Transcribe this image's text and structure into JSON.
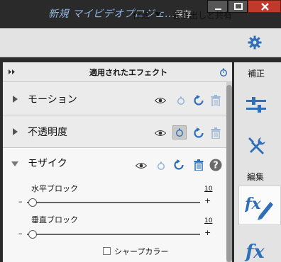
{
  "titlebar": {
    "title": "新規 マイビデオプロジェ...",
    "save": "保存"
  },
  "menubar": {
    "create": "作成",
    "share": "書き出しと共有"
  },
  "panel": {
    "title": "適用されたエフェクト"
  },
  "rightbar": {
    "adjust": "補正",
    "edit": "編集"
  },
  "effects": [
    {
      "name": "モーション"
    },
    {
      "name": "不透明度"
    },
    {
      "name": "モザイク"
    }
  ],
  "mosaic": {
    "horizontal_label": "水平ブロック",
    "horizontal_value": "10",
    "vertical_label": "垂直ブロック",
    "vertical_value": "10",
    "minus": "–",
    "plus": "+",
    "sharp_color_label": "シャープカラー",
    "sharp_color_checked": false
  },
  "colors": {
    "accent": "#2f6fb7",
    "title_text": "#8fb6e8"
  }
}
